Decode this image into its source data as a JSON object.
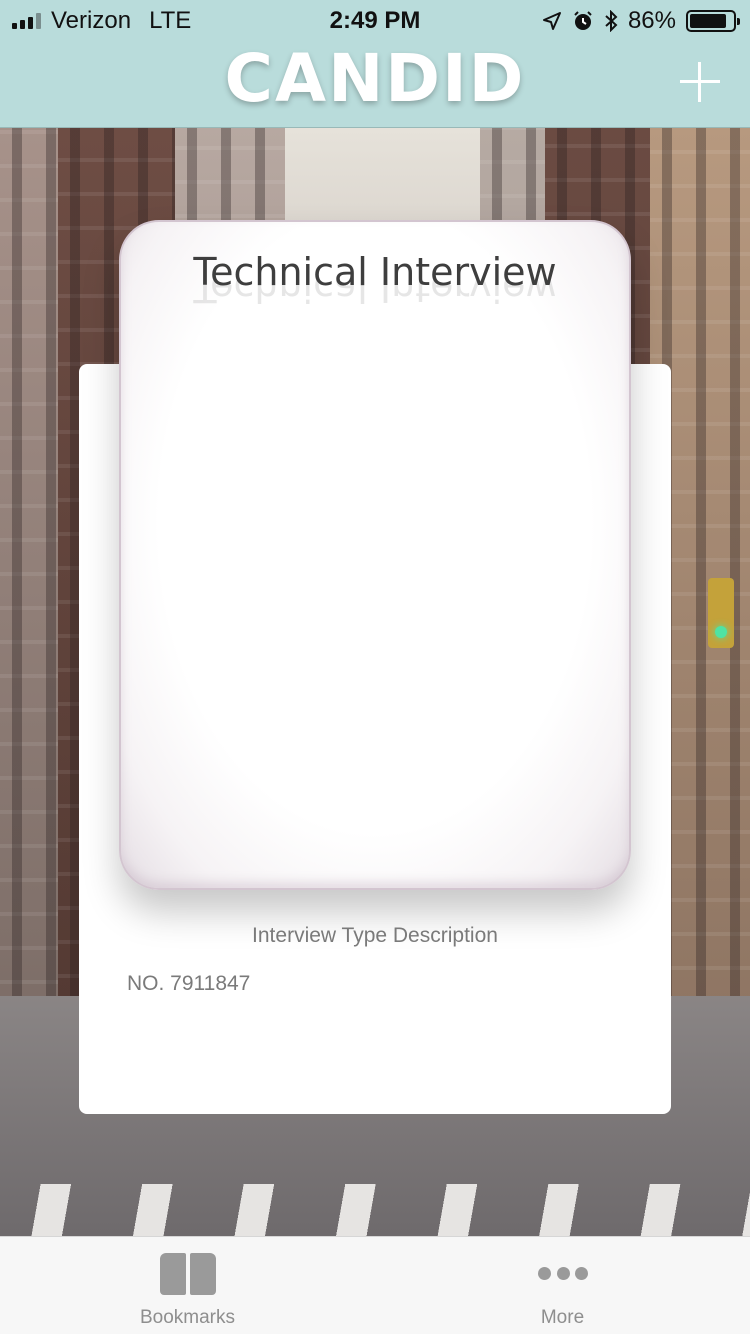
{
  "status_bar": {
    "carrier": "Verizon",
    "network": "LTE",
    "time": "2:49 PM",
    "battery_percent": "86%",
    "battery_level": 0.86,
    "icons": [
      "signal-icon",
      "location-icon",
      "alarm-icon",
      "bluetooth-icon",
      "battery-icon"
    ]
  },
  "nav": {
    "logo_text": "CANDID",
    "add_icon": "plus-icon"
  },
  "card": {
    "title": "Technical Interview",
    "description": "Interview Type Description",
    "number": "NO. 7911847"
  },
  "tabbar": {
    "items": [
      {
        "label": "Bookmarks",
        "icon": "book-icon"
      },
      {
        "label": "More",
        "icon": "ellipsis-icon"
      }
    ]
  },
  "colors": {
    "nav_background": "#b9dcdb",
    "card_background": "#ffffff",
    "tab_inactive": "#8e8e8e"
  }
}
